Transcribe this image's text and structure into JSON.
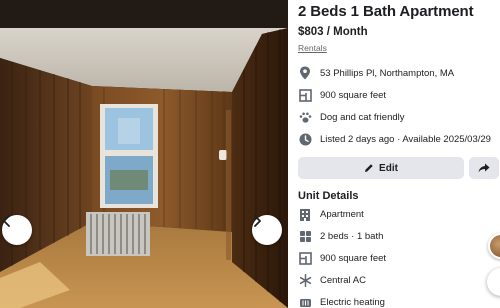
{
  "listing": {
    "title": "2 Beds 1 Bath Apartment",
    "price": "$803 / Month",
    "category": "Rentals"
  },
  "info": [
    {
      "icon": "location-pin-icon",
      "text": "53 Phillips Pl, Northampton, MA"
    },
    {
      "icon": "floorplan-icon",
      "text": "900 square feet"
    },
    {
      "icon": "paw-icon",
      "text": "Dog and cat friendly"
    },
    {
      "icon": "clock-icon",
      "text": "Listed 2 days ago · Available 2025/03/29"
    }
  ],
  "actions": {
    "edit_label": "Edit",
    "share_icon": "share-icon"
  },
  "unit_details": {
    "heading": "Unit Details",
    "items": [
      {
        "icon": "building-icon",
        "text": "Apartment"
      },
      {
        "icon": "bed-bath-icon",
        "text": "2 beds · 1 bath"
      },
      {
        "icon": "floorplan-icon",
        "text": "900 square feet"
      },
      {
        "icon": "snowflake-icon",
        "text": "Central AC"
      },
      {
        "icon": "heating-icon",
        "text": "Electric heating"
      }
    ]
  },
  "gallery": {
    "prev_icon": "chevron-left-icon",
    "next_icon": "chevron-right-icon"
  },
  "colors": {
    "text": "#1c1e21",
    "secondary": "#65676b",
    "button_bg": "#e4e6eb",
    "icon": "#606770"
  }
}
